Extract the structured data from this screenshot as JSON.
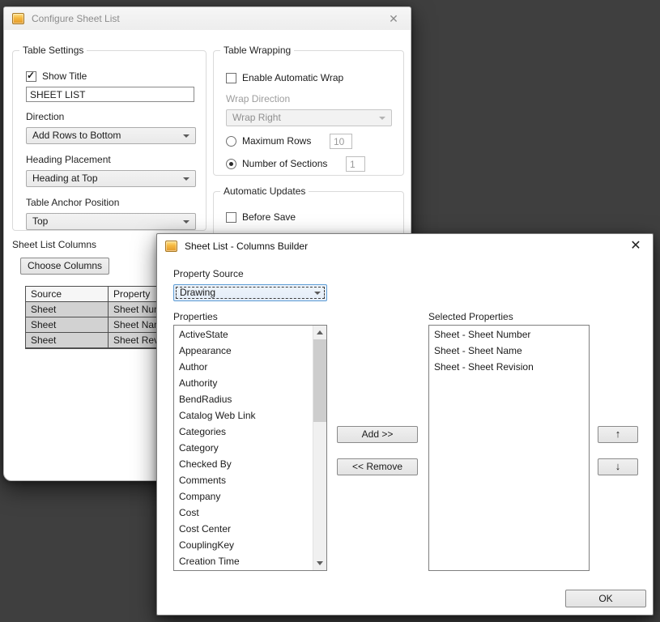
{
  "configure_dialog": {
    "title": "Configure Sheet List",
    "close_label": "✕",
    "table_settings": {
      "legend": "Table Settings",
      "show_title": "Show Title",
      "title_value": "SHEET LIST",
      "direction_label": "Direction",
      "direction_value": "Add Rows to Bottom",
      "heading_label": "Heading Placement",
      "heading_value": "Heading at Top",
      "anchor_label": "Table Anchor Position",
      "anchor_value": "Top"
    },
    "table_wrapping": {
      "legend": "Table Wrapping",
      "enable_wrap": "Enable Automatic Wrap",
      "wrap_direction_label": "Wrap Direction",
      "wrap_direction_value": "Wrap Right",
      "max_rows_label": "Maximum Rows",
      "max_rows_value": "10",
      "sections_label": "Number of Sections",
      "sections_value": "1"
    },
    "automatic_updates": {
      "legend": "Automatic Updates",
      "before_save": "Before Save"
    },
    "columns_section": {
      "legend": "Sheet List Columns",
      "choose_columns": "Choose Columns",
      "headers": [
        "Source",
        "Property"
      ],
      "rows": [
        [
          "Sheet",
          "Sheet Number"
        ],
        [
          "Sheet",
          "Sheet Name"
        ],
        [
          "Sheet",
          "Sheet Revision"
        ]
      ]
    }
  },
  "builder_dialog": {
    "title": "Sheet List - Columns Builder",
    "close_label": "✕",
    "property_source_label": "Property Source",
    "property_source_value": "Drawing",
    "properties_label": "Properties",
    "properties": [
      "ActiveState",
      "Appearance",
      "Author",
      "Authority",
      "BendRadius",
      "Catalog Web Link",
      "Categories",
      "Category",
      "Checked By",
      "Comments",
      "Company",
      "Cost",
      "Cost Center",
      "CouplingKey",
      "Creation Time"
    ],
    "selected_label": "Selected Properties",
    "selected": [
      "Sheet - Sheet Number",
      "Sheet - Sheet Name",
      "Sheet - Sheet Revision"
    ],
    "add_label": "Add >>",
    "remove_label": "<< Remove",
    "up_label": "↑",
    "down_label": "↓",
    "ok_label": "OK"
  },
  "colors": {
    "background": "#3f3f3f",
    "icon_gold": "#f5b73e"
  }
}
